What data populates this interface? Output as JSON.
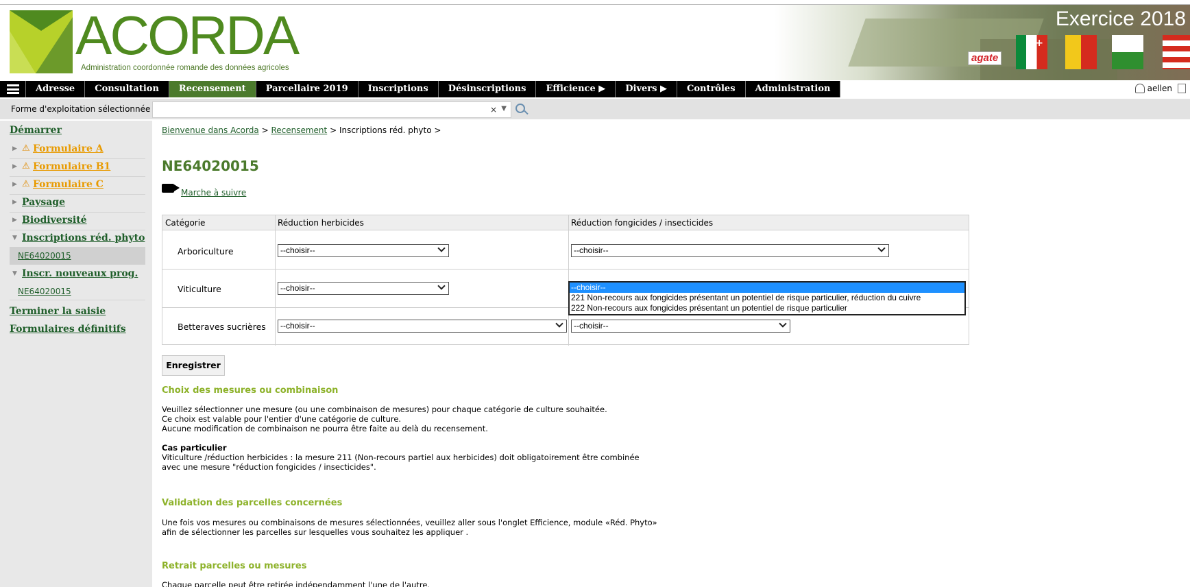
{
  "header": {
    "brand": "ACORDA",
    "tagline": "Administration coordonnée romande des données agricoles",
    "exercise": "Exercice 2018",
    "agate": "agate"
  },
  "nav": {
    "items": [
      {
        "label": "Adresse"
      },
      {
        "label": "Consultation"
      },
      {
        "label": "Recensement",
        "active": true
      },
      {
        "label": "Parcellaire 2019"
      },
      {
        "label": "Inscriptions"
      },
      {
        "label": "Désinscriptions"
      },
      {
        "label": "Efficience ▶"
      },
      {
        "label": "Divers ▶"
      },
      {
        "label": "Contrôles"
      },
      {
        "label": "Administration"
      }
    ],
    "user": "aellen"
  },
  "filter": {
    "label": "Forme d'exploitation sélectionnée",
    "clear": "×",
    "caret": "▼",
    "value": ""
  },
  "sidebar": {
    "start": "Démarrer",
    "items": [
      {
        "label": "Formulaire A",
        "warning": true
      },
      {
        "label": "Formulaire B1",
        "warning": true
      },
      {
        "label": "Formulaire C",
        "warning": true
      },
      {
        "label": "Paysage"
      },
      {
        "label": "Biodiversité"
      },
      {
        "label": "Inscriptions réd. phyto",
        "child": "NE64020015"
      },
      {
        "label": "Inscr. nouveaux prog.",
        "child": "NE64020015"
      }
    ],
    "finish": "Terminer la saisie",
    "final_forms": "Formulaires définitifs"
  },
  "breadcrumb": {
    "home": "Bienvenue dans Acorda",
    "sep1": ">",
    "section": "Recensement",
    "sep2": ">",
    "current": "Inscriptions réd. phyto",
    "sep3": ">"
  },
  "page": {
    "title": "NE64020015",
    "guide": "Marche à suivre"
  },
  "table": {
    "headers": [
      "Catégorie",
      "Réduction herbicides",
      "Réduction fongicides / insecticides"
    ],
    "rows": [
      {
        "category": "Arboriculture",
        "herb": "--choisir--",
        "fong": "--choisir--"
      },
      {
        "category": "Viticulture",
        "herb": "--choisir--",
        "fong": "--choisir--"
      },
      {
        "category": "Betteraves sucrières",
        "herb": "--choisir--",
        "fong": "--choisir--"
      }
    ],
    "dropdown_options": [
      "--choisir--",
      "221 Non-recours aux fongicides présentant un potentiel de risque particulier, réduction du cuivre",
      "222 Non-recours aux fongicides présentant un potentiel de risque particulier"
    ]
  },
  "save_label": "Enregistrer",
  "sections": {
    "choice_title": "Choix des mesures ou combinaison",
    "choice_l1": "Veuillez sélectionner une mesure (ou une combinaison de mesures) pour chaque catégorie de culture souhaitée.",
    "choice_l2": "Ce choix est valable pour l'entier d'une catégorie de culture.",
    "choice_l3": "Aucune modification de combinaison ne pourra être faite au delà du recensement.",
    "special_title": "Cas particulier",
    "special_l1": "Viticulture /réduction herbicides : la mesure 211 (Non-recours partiel aux herbicides) doit obligatoirement être combinée",
    "special_l2": "avec une mesure \"réduction fongicides / insecticides\".",
    "validation_title": "Validation des parcelles concernées",
    "validation_l1": "Une fois vos mesures ou combinaisons de mesures sélectionnées, veuillez aller sous l'onglet Efficience, module «Réd. Phyto»",
    "validation_l2": "afin de sélectionner les parcelles sur lesquelles vous souhaitez les appliquer .",
    "withdraw_title": "Retrait parcelles ou mesures",
    "withdraw_l1": "Chaque parcelle peut être retirée indépendamment l'une de l'autre."
  },
  "colors": {
    "brand_green": "#4f8a1f",
    "nav_active": "#4b7a2c",
    "link_green": "#1f5e2a",
    "section_green": "#8db22a",
    "warning_orange": "#e89a00",
    "select_highlight": "#1e90ff"
  },
  "icons": [
    "menu-icon",
    "user-icon",
    "logout-icon",
    "search-icon",
    "warning-icon",
    "video-camera-icon",
    "chevron-down-icon",
    "triangle-right-icon",
    "triangle-down-icon"
  ]
}
